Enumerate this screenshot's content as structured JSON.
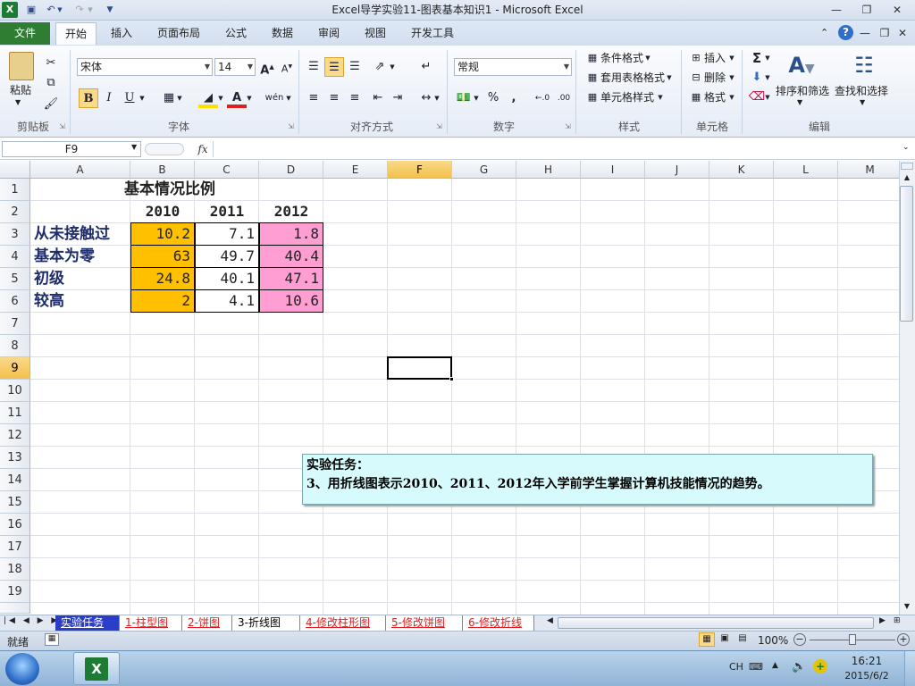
{
  "window": {
    "title": "Excel导学实验11-图表基本知识1  -  Microsoft Excel"
  },
  "ribbon": {
    "tabs": [
      "文件",
      "开始",
      "插入",
      "页面布局",
      "公式",
      "数据",
      "审阅",
      "视图",
      "开发工具"
    ],
    "active_tab": "开始",
    "clipboard": {
      "paste_label": "粘贴",
      "group_label": "剪贴板"
    },
    "font": {
      "family": "宋体",
      "size": "14",
      "group_label": "字体",
      "bold": "B",
      "italic": "I",
      "underline": "U"
    },
    "alignment": {
      "group_label": "对齐方式"
    },
    "number": {
      "format": "常规",
      "group_label": "数字",
      "percent": "%",
      "comma": ","
    },
    "styles": {
      "conditional": "条件格式",
      "table": "套用表格格式",
      "cell": "单元格样式",
      "group_label": "样式"
    },
    "cells": {
      "insert": "插入",
      "delete": "删除",
      "format": "格式",
      "group_label": "单元格"
    },
    "editing": {
      "sort": "排序和筛选",
      "find": "查找和选择",
      "group_label": "编辑",
      "sigma": "Σ"
    }
  },
  "formula_bar": {
    "name_box": "F9",
    "fx": "fx",
    "value": ""
  },
  "grid": {
    "columns": [
      "A",
      "B",
      "C",
      "D",
      "E",
      "F",
      "G",
      "H",
      "I",
      "J",
      "K",
      "L",
      "M"
    ],
    "rows": [
      "1",
      "2",
      "3",
      "4",
      "5",
      "6",
      "7",
      "8",
      "9",
      "10",
      "11",
      "12",
      "13",
      "14",
      "15",
      "16",
      "17",
      "18",
      "19"
    ],
    "active_cell": "F9",
    "title": "基本情况比例",
    "year_headers": [
      "2010",
      "2011",
      "2012"
    ],
    "row_labels": [
      "从未接触过",
      "基本为零",
      "初级",
      "较高"
    ],
    "values": [
      [
        "10.2",
        "7.1",
        "1.8"
      ],
      [
        "63",
        "49.7",
        "40.4"
      ],
      [
        "24.8",
        "40.1",
        "47.1"
      ],
      [
        "2",
        "4.1",
        "10.6"
      ]
    ]
  },
  "note": {
    "line1": "实验任务：",
    "line2": "3、用折线图表示2010、2011、2012年入学前学生掌握计算机技能情况的趋势。"
  },
  "sheet_tabs": [
    {
      "label": "实验任务",
      "style": "blue"
    },
    {
      "label": "1-柱型图",
      "style": "red"
    },
    {
      "label": "2-饼图",
      "style": "red"
    },
    {
      "label": "3-折线图",
      "style": "active"
    },
    {
      "label": "4-修改柱形图",
      "style": "red"
    },
    {
      "label": "5-修改饼图",
      "style": "red"
    },
    {
      "label": "6-修改折线",
      "style": "red"
    }
  ],
  "status": {
    "ready": "就绪",
    "zoom": "100%"
  },
  "taskbar": {
    "ime": "CH",
    "time": "16:21",
    "date": "2015/6/2"
  }
}
